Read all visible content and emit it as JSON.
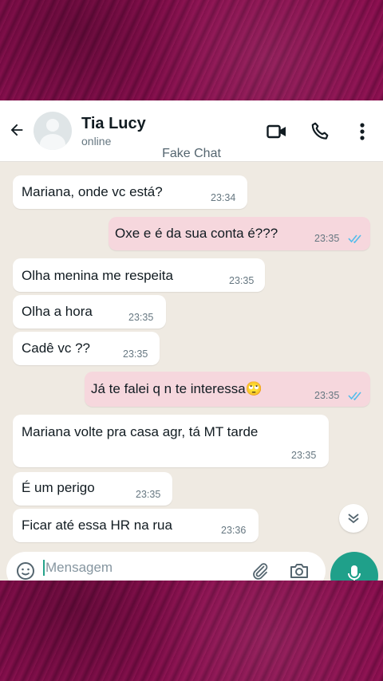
{
  "header": {
    "contact_name": "Tia Lucy",
    "status": "online",
    "watermark": "Fake Chat",
    "icons": [
      "back-arrow-icon",
      "video-call-icon",
      "voice-call-icon",
      "more-options-icon"
    ]
  },
  "messages": [
    {
      "direction": "in",
      "text": "Mariana, onde vc está?",
      "time": "23:34"
    },
    {
      "direction": "out",
      "text": "Oxe e é da sua conta é???",
      "time": "23:35",
      "status": "read"
    },
    {
      "direction": "in",
      "text": "Olha menina me respeita",
      "time": "23:35"
    },
    {
      "direction": "in",
      "text": "Olha a hora",
      "time": "23:35"
    },
    {
      "direction": "in",
      "text": "Cadê vc ??",
      "time": "23:35"
    },
    {
      "direction": "out",
      "text": "Já te falei q n te interessa🙄",
      "time": "23:35",
      "status": "read"
    },
    {
      "direction": "in",
      "text": "Mariana volte pra casa agr, tá MT tarde",
      "time": "23:35"
    },
    {
      "direction": "in",
      "text": "É um perigo",
      "time": "23:35"
    },
    {
      "direction": "in",
      "text": "Ficar até essa HR na rua",
      "time": "23:36"
    }
  ],
  "composer": {
    "placeholder": "Mensagem",
    "icons": [
      "emoji-icon",
      "attach-icon",
      "camera-icon",
      "mic-icon"
    ]
  },
  "colors": {
    "band": "#8a0e4f",
    "chat_background": "#efeae2",
    "incoming_bubble": "#ffffff",
    "outgoing_bubble": "#f6d7dd",
    "read_ticks": "#53bdeb",
    "mic_button": "#1fa08a"
  }
}
